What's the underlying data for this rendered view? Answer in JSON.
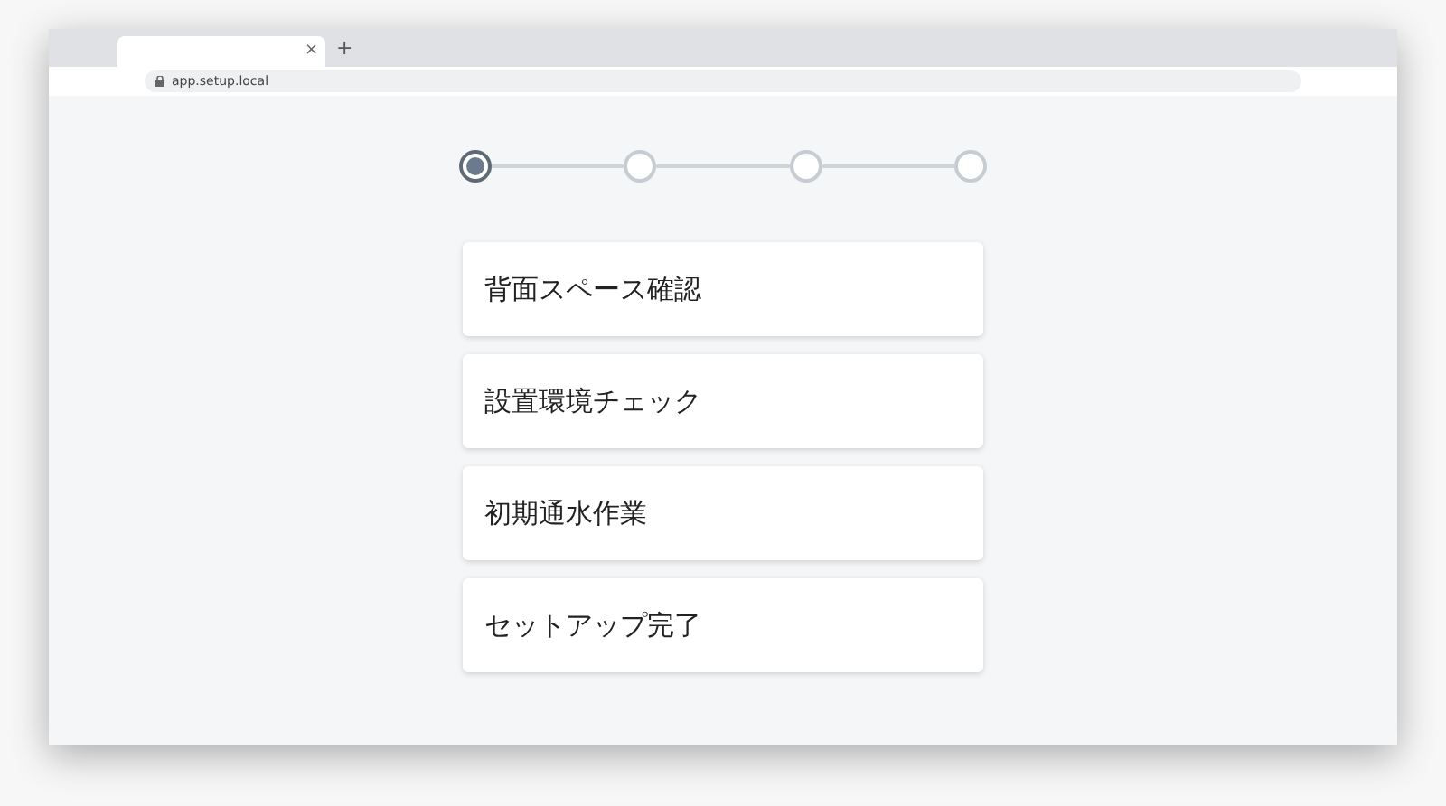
{
  "browser": {
    "tab_close": "×",
    "new_tab": "+",
    "url": "app.setup.local"
  },
  "steps": [
    {
      "selected": true
    },
    {
      "selected": false
    },
    {
      "selected": false
    },
    {
      "selected": false
    }
  ],
  "cards": [
    {
      "title": "背面スペース確認"
    },
    {
      "title": "設置環境チェック"
    },
    {
      "title": "初期通水作業"
    },
    {
      "title": "セットアップ完了"
    }
  ]
}
